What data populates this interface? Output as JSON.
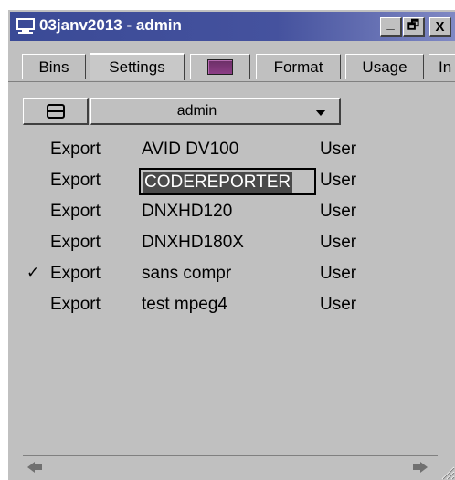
{
  "window": {
    "title": "03janv2013 - admin",
    "controls": [
      "_",
      "🗗",
      "X"
    ]
  },
  "tabs": [
    {
      "label": "Bins"
    },
    {
      "label": "Settings",
      "active": true
    },
    {
      "label": ""
    },
    {
      "label": "Format"
    },
    {
      "label": "Usage"
    },
    {
      "label": "In"
    }
  ],
  "toolbar": {
    "user_dropdown_value": "admin"
  },
  "settings_list": [
    {
      "type": "Export",
      "name": "AVID DV100",
      "owner": "User",
      "checked": false,
      "editing": false
    },
    {
      "type": "Export",
      "name": "CODEREPORTER",
      "owner": "User",
      "checked": false,
      "editing": true
    },
    {
      "type": "Export",
      "name": "DNXHD120",
      "owner": "User",
      "checked": false,
      "editing": false
    },
    {
      "type": "Export",
      "name": "DNXHD180X",
      "owner": "User",
      "checked": false,
      "editing": false
    },
    {
      "type": "Export",
      "name": "sans compr",
      "owner": "User",
      "checked": true,
      "editing": false
    },
    {
      "type": "Export",
      "name": "test mpeg4",
      "owner": "User",
      "checked": false,
      "editing": false
    }
  ],
  "check_glyph": "✓",
  "colors": {
    "title_bar": "#3a4a96",
    "window_bg": "#c0c0c0",
    "edit_highlight": "#4a4a4a",
    "tab_swatch": "#7a3574"
  }
}
